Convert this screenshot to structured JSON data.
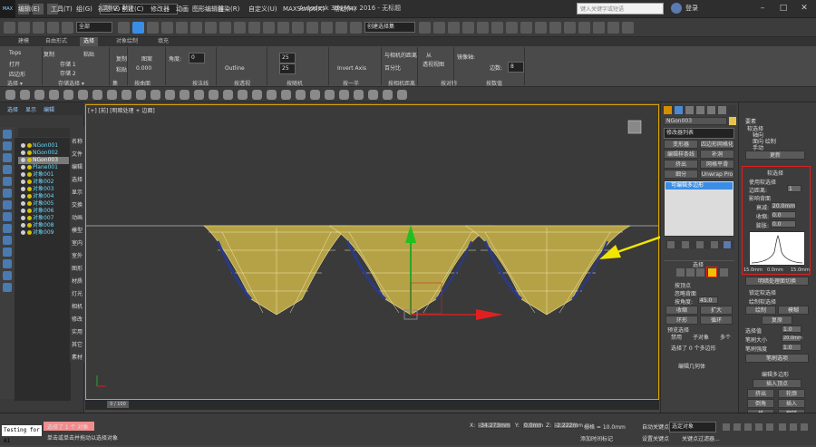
{
  "app": {
    "icon_label": "MAX",
    "title": "Autodesk 3ds Max 2016 - 无标题",
    "workspace_label": "工作区: 默认",
    "search_placeholder": "键入关键字或短语",
    "login_label": "登录"
  },
  "menu": [
    "编辑(E)",
    "工具(T)",
    "组(G)",
    "视图(V)",
    "创建(C)",
    "修改器",
    "动画",
    "图形编辑器",
    "渲染(R)",
    "自定义(U)",
    "MAXScript(X)",
    "帮助(H)"
  ],
  "toolbar": {
    "filter_value": "全部",
    "selection_set_value": "创建选择集"
  },
  "ribbon": {
    "tabs": [
      "建模",
      "自由形式",
      "选择",
      "对象绘制",
      "填充"
    ],
    "active_tab": "选择",
    "row_items": {
      "tops": "Tops",
      "open": "打开",
      "fourbox": "四边形",
      "copy": "复制",
      "paste": "粘贴",
      "store1": "存储 1",
      "store2": "存储 2",
      "copy2": "复制",
      "paste2": "粘贴",
      "pattern": "图案",
      "angle": "角度:",
      "angle_value": "0",
      "outline": "Outline",
      "mesh_num1": "25",
      "mesh_num2": "25",
      "invert_axis": "Invert Axis",
      "distance_similar": "与相机的距离",
      "percent": "百分比",
      "from": "从",
      "perspective_view": "透视视图",
      "mirror_axis": "镜像轴:",
      "edge_count": "边数:",
      "edge_value": "8",
      "value_zero": "0.000"
    },
    "sections": [
      "选择 ▾",
      "存储选择 ▾",
      "集",
      "按曲面",
      "按法线",
      "按透视",
      "按随机",
      "按一半",
      "按相机距离",
      "按对称",
      "按数值"
    ]
  },
  "scene": {
    "tabs": [
      "选择",
      "显示",
      "编辑"
    ],
    "items": [
      "NGon001",
      "NGon002",
      "NGon003",
      "Plane001",
      "对象001",
      "对象002",
      "对象003",
      "对象004",
      "对象005",
      "对象006",
      "对象007",
      "对象008",
      "对象009"
    ],
    "selected_index": 2,
    "nav": [
      "名称",
      "文件",
      "编辑",
      "选择",
      "显示",
      "交换",
      "动画",
      "模型",
      "室内",
      "室外",
      "图形",
      "材质",
      "灯光",
      "相机",
      "修改",
      "实用",
      "其它",
      "素材"
    ]
  },
  "viewport": {
    "label": "[+] [前] [明暗处理 + 边面]",
    "timeline": "0 / 100"
  },
  "modify_panel": {
    "object_name": "NGon003",
    "modifier_list": "修改器列表",
    "buttons": [
      "变形器",
      "四边形网格化",
      "编辑样条线",
      "补洞",
      "挤出",
      "网格平滑",
      "细分",
      "Unwrap Pro"
    ],
    "stack_item": "可编辑多边形",
    "rollout_select": "选择",
    "opt1": "按顶点",
    "opt2": "忽略背面",
    "opt3": "按角度:",
    "angle_val": "45.0",
    "shrink": "收缩",
    "grow": "扩大",
    "ring": "环形",
    "loop": "循环",
    "preview_title": "预览选择",
    "preview_disabled": "禁用",
    "preview_sub": "子对象",
    "preview_multi": "多个",
    "selected_count": "选择了 0 个多边形",
    "edit_geometry": "编辑几何体"
  },
  "far_right": {
    "stack_header": "要素",
    "items1": [
      "软选择",
      "轴向",
      "面向 绘制",
      "手动"
    ],
    "btn_update": "更新",
    "soft_title": "软选择",
    "use_soft": "使用软选择",
    "edge_dist": "边距离:",
    "edge_dist_val": "1",
    "affect_back": "影响背面",
    "falloff": "衰减:",
    "falloff_val": "20.0mm",
    "pinch": "收缩:",
    "pinch_val": "0.0",
    "bubble": "膨胀:",
    "bubble_val": "0.0",
    "curve_labels": [
      "15.0mm",
      "0.0mm",
      "15.0mm"
    ],
    "shaded_face": "明暗处理面切换",
    "lock_soft": "锁定软选择",
    "paint_soft": "绘制软选择",
    "paint": "绘制",
    "blur": "模糊",
    "revert": "复原",
    "sel_value": "选择值",
    "sel_value_val": "1.0",
    "brush_size": "笔刷大小",
    "brush_size_val": "20.0mm",
    "brush_strength": "笔刷强度",
    "brush_strength_val": "1.0",
    "brush_options": "笔刷选项",
    "edit_poly": "编辑多边形",
    "insert_vertex": "插入顶点",
    "extrude": "挤出",
    "outline": "轮廓",
    "bevel": "倒角",
    "insert": "插入",
    "bridge": "桥",
    "flip": "翻转"
  },
  "status": {
    "script_label": "Testing for AI",
    "selected": "选择了 1 个 对象",
    "hint": "单击或单击并拖动以选择对象",
    "x_val": "-34.273mm",
    "y_val": "0.0mm",
    "z_val": "-2.222mm",
    "grid": "栅格 = 10.0mm",
    "add_time_tag": "添加时间标记",
    "auto_key": "自动关键点",
    "set_key": "设置关键点",
    "selected_obj": "选定对象",
    "key_filter": "关键点过滤器..."
  },
  "colors": {
    "accent": "#d9a300",
    "highlight_red": "#e02020",
    "selection_blue": "#3a8ee6",
    "object_fill": "#b6a246"
  }
}
